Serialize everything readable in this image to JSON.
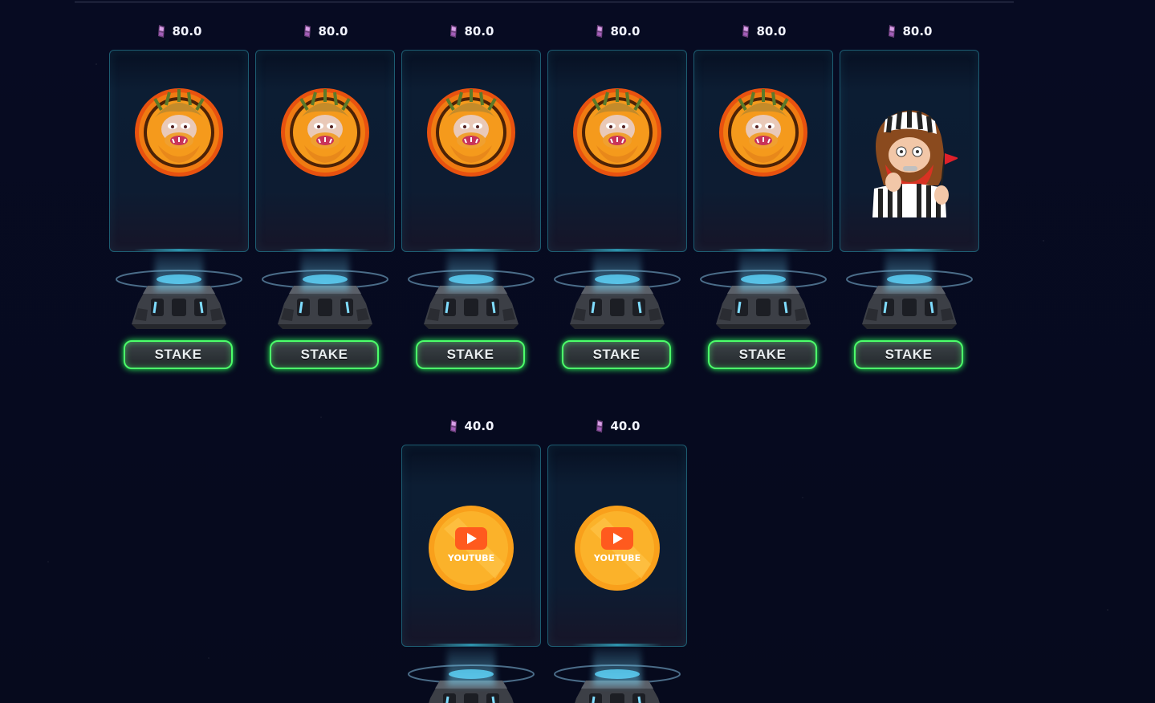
{
  "row1": [
    {
      "price": "80.0",
      "nft": "caveman-medallion-icon",
      "button": "STAKE"
    },
    {
      "price": "80.0",
      "nft": "caveman-medallion-icon",
      "button": "STAKE"
    },
    {
      "price": "80.0",
      "nft": "caveman-medallion-icon",
      "button": "STAKE"
    },
    {
      "price": "80.0",
      "nft": "caveman-medallion-icon",
      "button": "STAKE"
    },
    {
      "price": "80.0",
      "nft": "caveman-medallion-icon",
      "button": "STAKE"
    },
    {
      "price": "80.0",
      "nft": "referee-caveman-icon",
      "button": "STAKE"
    }
  ],
  "row2": [
    {
      "price": "40.0",
      "nft": "youtube-coin-icon",
      "coin_text": "YOUTUBE"
    },
    {
      "price": "40.0",
      "nft": "youtube-coin-icon",
      "coin_text": "YOUTUBE"
    }
  ],
  "colors": {
    "background": "#060a1e",
    "card_border": "#1d5d72",
    "button_glow": "#4cff6a",
    "token": "#8a4d9c"
  }
}
